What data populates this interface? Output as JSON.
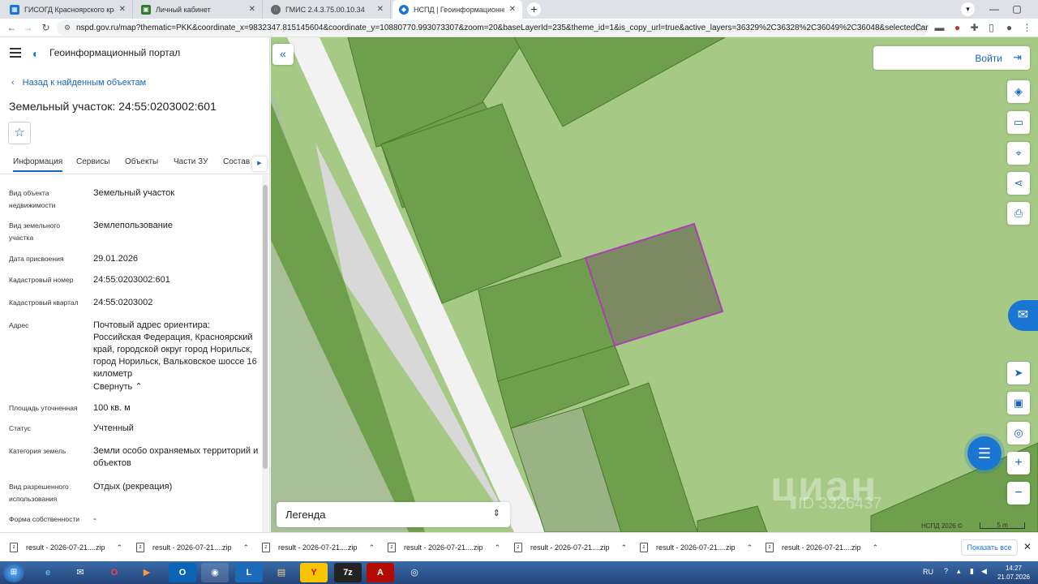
{
  "browser": {
    "tabs": [
      {
        "title": "ГИСОГД Красноярского края",
        "icon": "map-icon"
      },
      {
        "title": "Личный кабинет",
        "icon": "cabinet-icon"
      },
      {
        "title": "ГМИС 2.4.3.75.00.10.34",
        "icon": "globe-icon"
      },
      {
        "title": "НСПД | Геоинформационный п",
        "icon": "nspd-icon"
      }
    ],
    "url": "nspd.gov.ru/map?thematic=PKK&coordinate_x=9832347.815145604&coordinate_y=10880770.993073307&zoom=20&baseLayerId=235&theme_id=1&is_copy_url=true&active_layers=36329%2C36328%2C36049%2C36048&selectedCard=135..."
  },
  "sidebar": {
    "portal_title": "Геоинформационный портал",
    "back_label": "Назад к найденным объектам",
    "object_title": "Земельный участок: 24:55:0203002:601",
    "tabs": [
      "Информация",
      "Сервисы",
      "Объекты",
      "Части ЗУ",
      "Состав"
    ],
    "properties": [
      {
        "key": "Вид объекта недвижимости",
        "value": "Земельный участок"
      },
      {
        "key": "Вид земельного участка",
        "value": "Землепользование"
      },
      {
        "key": "Дата присвоения",
        "value": "29.01.2026"
      },
      {
        "key": "Кадастровый номер",
        "value": "24:55:0203002:601"
      },
      {
        "key": "Кадастровый квартал",
        "value": "24:55:0203002"
      },
      {
        "key": "Адрес",
        "value": "Почтовый адрес ориентира: Российская Федерация, Красноярский край, городской округ город Норильск, город Норильск, Вальковское шоссе 16 километр"
      },
      {
        "key": "Площадь уточненная",
        "value": "100 кв. м"
      },
      {
        "key": "Статус",
        "value": "Учтенный"
      },
      {
        "key": "Категория земель",
        "value": "Земли особо охраняемых территорий и объектов"
      },
      {
        "key": "Вид разрешенного использования",
        "value": "Отдых (рекреация)"
      },
      {
        "key": "Форма собственности",
        "value": "-"
      }
    ],
    "collapse_label": "Свернуть"
  },
  "map": {
    "login_label": "Войти",
    "legend_label": "Легенда",
    "attribution": "НСПД 2026 ©",
    "scale_label": "5 m",
    "watermark": "циан",
    "watermark_id": "ID 3326437",
    "colors": {
      "base": "#a6c986",
      "parcel": "#6e9f4c",
      "selected_border": "#b03db5",
      "selected_fill": "#7c8a63"
    }
  },
  "downloads": {
    "items": [
      "result - 2026-07-21....zip",
      "result - 2026-07-21....zip",
      "result - 2026-07-21....zip",
      "result - 2026-07-21....zip",
      "result - 2026-07-21....zip",
      "result - 2026-07-21....zip",
      "result - 2026-07-21....zip"
    ],
    "show_all": "Показать все"
  },
  "taskbar": {
    "lang": "RU",
    "time": "14:27",
    "date": "21.07.2026"
  }
}
